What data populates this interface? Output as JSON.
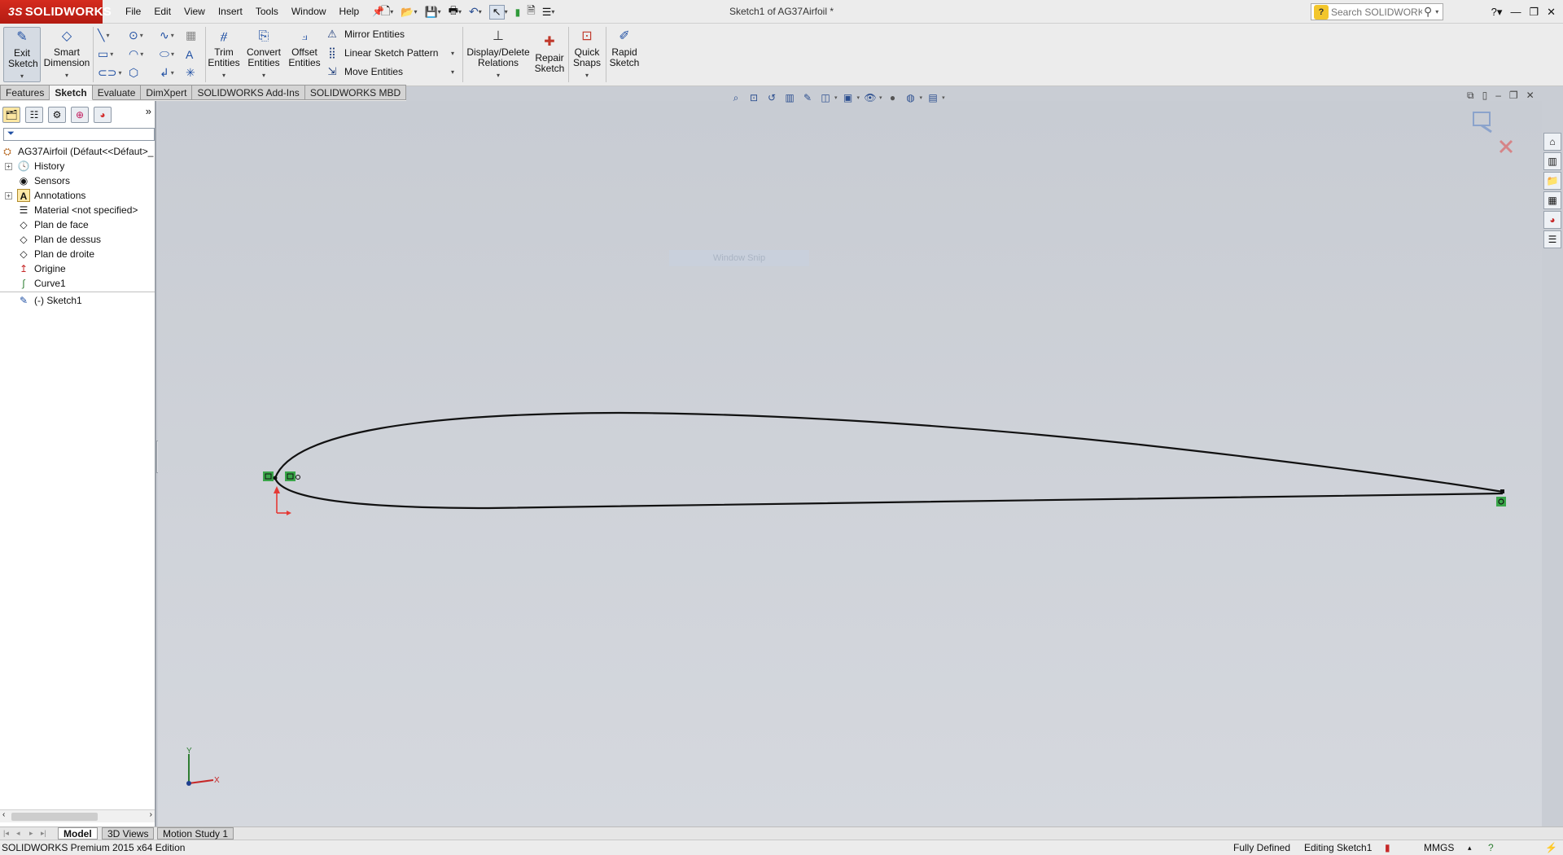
{
  "app": {
    "brand": "SOLIDWORKS",
    "brand_prefix": "3S",
    "document_title": "Sketch1 of AG37Airfoil *"
  },
  "menu": [
    "File",
    "Edit",
    "View",
    "Insert",
    "Tools",
    "Window",
    "Help"
  ],
  "search": {
    "placeholder": "Search SOLIDWORKS Help"
  },
  "command_manager": {
    "exit_sketch": "Exit Sketch",
    "smart_dimension": "Smart Dimension",
    "trim_entities": "Trim Entities",
    "convert_entities": "Convert Entities",
    "offset_entities": "Offset Entities",
    "mirror_entities": "Mirror Entities",
    "linear_sketch_pattern": "Linear Sketch Pattern",
    "move_entities": "Move Entities",
    "display_delete_relations": "Display/Delete Relations",
    "repair_sketch": "Repair Sketch",
    "quick_snaps": "Quick Snaps",
    "rapid_sketch": "Rapid Sketch"
  },
  "tabs": [
    {
      "label": "Features",
      "active": false
    },
    {
      "label": "Sketch",
      "active": true
    },
    {
      "label": "Evaluate",
      "active": false
    },
    {
      "label": "DimXpert",
      "active": false
    },
    {
      "label": "SOLIDWORKS Add-Ins",
      "active": false
    },
    {
      "label": "SOLIDWORKS MBD",
      "active": false
    }
  ],
  "feature_tree": {
    "root": "AG37Airfoil  (Défaut<<Défaut>_",
    "items": [
      {
        "label": "History",
        "icon": "history-icon",
        "expandable": true
      },
      {
        "label": "Sensors",
        "icon": "sensors-icon",
        "expandable": false
      },
      {
        "label": "Annotations",
        "icon": "annotations-icon",
        "expandable": true
      },
      {
        "label": "Material <not specified>",
        "icon": "material-icon",
        "expandable": false
      },
      {
        "label": "Plan de face",
        "icon": "plane-icon",
        "expandable": false
      },
      {
        "label": "Plan de dessus",
        "icon": "plane-icon",
        "expandable": false
      },
      {
        "label": "Plan de droite",
        "icon": "plane-icon",
        "expandable": false
      },
      {
        "label": "Origine",
        "icon": "origin-icon",
        "expandable": false
      },
      {
        "label": "Curve1",
        "icon": "curve-icon",
        "expandable": false
      }
    ],
    "active_sketch": "(-) Sketch1"
  },
  "graphics": {
    "window_snip": "Window Snip",
    "triad_x": "X",
    "triad_y": "Y"
  },
  "bottom_tabs": [
    {
      "label": "Model",
      "active": true
    },
    {
      "label": "3D Views",
      "active": false
    },
    {
      "label": "Motion Study 1",
      "active": false
    }
  ],
  "status": {
    "edition": "SOLIDWORKS Premium 2015 x64 Edition",
    "definition": "Fully Defined",
    "editing": "Editing Sketch1",
    "units": "MMGS"
  },
  "colors": {
    "brand_red": "#d52b1e",
    "sketch_line": "#111111",
    "relation_green": "#3aa64a",
    "origin_red": "#e53935"
  }
}
